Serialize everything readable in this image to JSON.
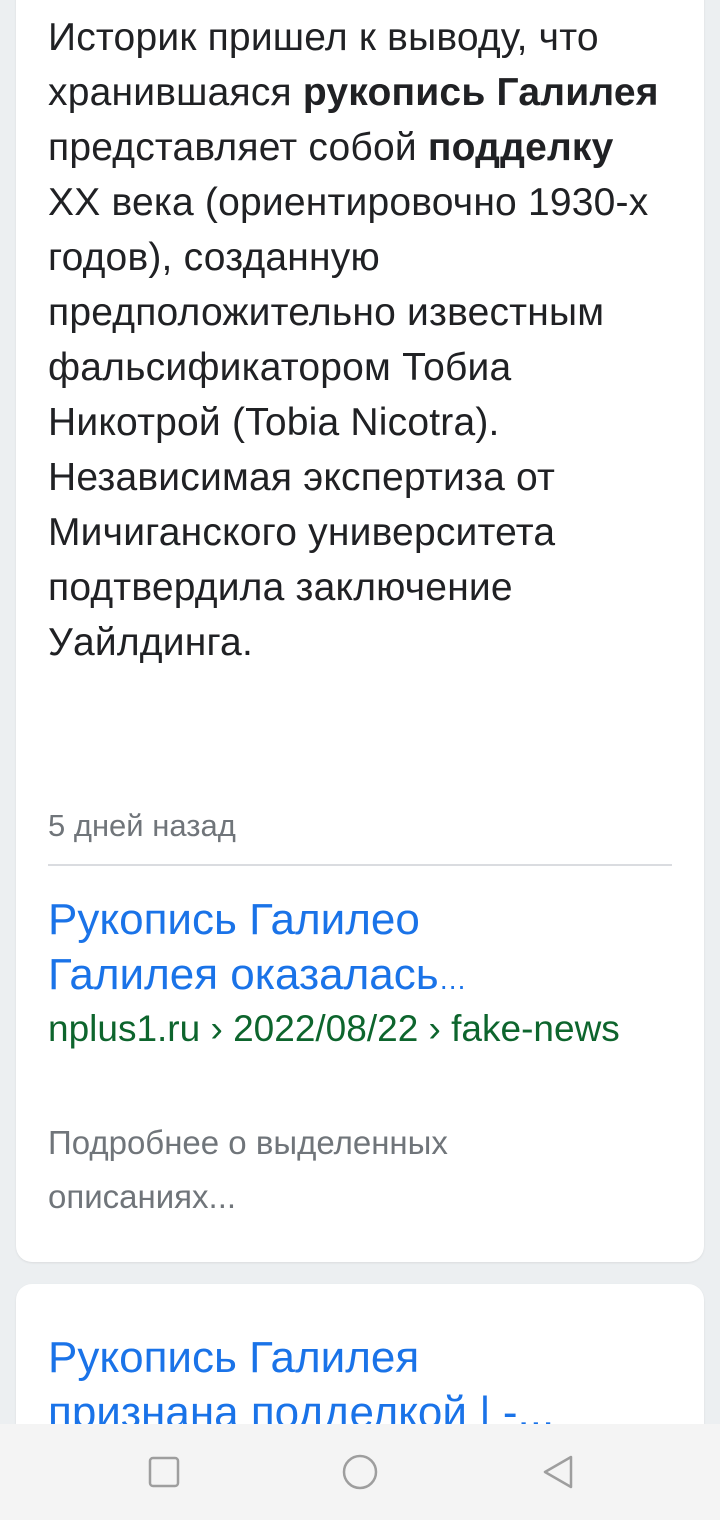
{
  "result_card": {
    "snippet": {
      "p1": "Историк пришел к выводу, что хранившаяся ",
      "b1": "рукопись Галилея",
      "p2": " представляет собой ",
      "b2": "подделку",
      "p3": " XX века (ориентировочно 1930-х годов), созданную предположительно известным фальсификатором Тобиа Никотрой (Tobia Nicotra). Независимая экспертиза от Мичиганского университета подтвердила заключение Уайлдинга."
    },
    "date": "5 дней назад",
    "title_line1": "Рукопись Галилео",
    "title_line2": "Галилея оказалась",
    "title_ellipsis": "…",
    "breadcrumb": "nplus1.ru › 2022/08/22 › fake-news",
    "about_link": "Подробнее о выделенных описаниях..."
  },
  "next_result": {
    "title_line1": "Рукопись Галилея",
    "title_line2": "признана подделкой | -..."
  },
  "nav_bar": {
    "icons": [
      "square-recents-icon",
      "circle-home-icon",
      "triangle-back-icon"
    ]
  },
  "colors": {
    "link_blue": "#1a73e8",
    "url_green": "#0d652d",
    "meta_gray": "#70757a",
    "text_dark": "#202124"
  }
}
